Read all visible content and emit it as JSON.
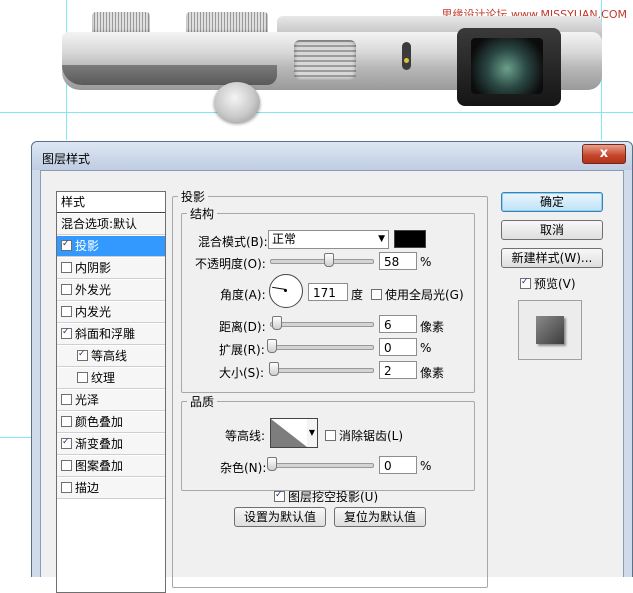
{
  "watermark": "思缘设计论坛 www.MISSYUAN.COM",
  "dialog": {
    "title": "图层样式",
    "close_label": "x"
  },
  "styles_list": {
    "header": "样式",
    "blend_options": "混合选项:默认",
    "items": [
      {
        "label": "投影",
        "checked": true,
        "selected": true
      },
      {
        "label": "内阴影",
        "checked": false
      },
      {
        "label": "外发光",
        "checked": false
      },
      {
        "label": "内发光",
        "checked": false
      },
      {
        "label": "斜面和浮雕",
        "checked": true
      },
      {
        "label": "等高线",
        "checked": true,
        "sub": true
      },
      {
        "label": "纹理",
        "checked": false,
        "sub": true
      },
      {
        "label": "光泽",
        "checked": false
      },
      {
        "label": "颜色叠加",
        "checked": false
      },
      {
        "label": "渐变叠加",
        "checked": true
      },
      {
        "label": "图案叠加",
        "checked": false
      },
      {
        "label": "描边",
        "checked": false
      }
    ]
  },
  "drop_shadow": {
    "section_title": "投影",
    "structure": {
      "title": "结构",
      "blend_mode_label": "混合模式(B):",
      "blend_mode_value": "正常",
      "shadow_color": "#000000",
      "opacity_label": "不透明度(O):",
      "opacity_value": "58",
      "opacity_unit": "%",
      "angle_label": "角度(A):",
      "angle_value": "171",
      "angle_unit": "度",
      "global_light_label": "使用全局光(G)",
      "distance_label": "距离(D):",
      "distance_value": "6",
      "distance_unit": "像素",
      "spread_label": "扩展(R):",
      "spread_value": "0",
      "spread_unit": "%",
      "size_label": "大小(S):",
      "size_value": "2",
      "size_unit": "像素"
    },
    "quality": {
      "title": "品质",
      "contour_label": "等高线:",
      "anti_alias_label": "消除锯齿(L)",
      "noise_label": "杂色(N):",
      "noise_value": "0",
      "noise_unit": "%"
    },
    "knockout_label": "图层挖空投影(U)",
    "make_default_label": "设置为默认值",
    "reset_default_label": "复位为默认值"
  },
  "buttons": {
    "ok": "确定",
    "cancel": "取消",
    "new_style": "新建样式(W)...",
    "preview_label": "预览(V)"
  }
}
